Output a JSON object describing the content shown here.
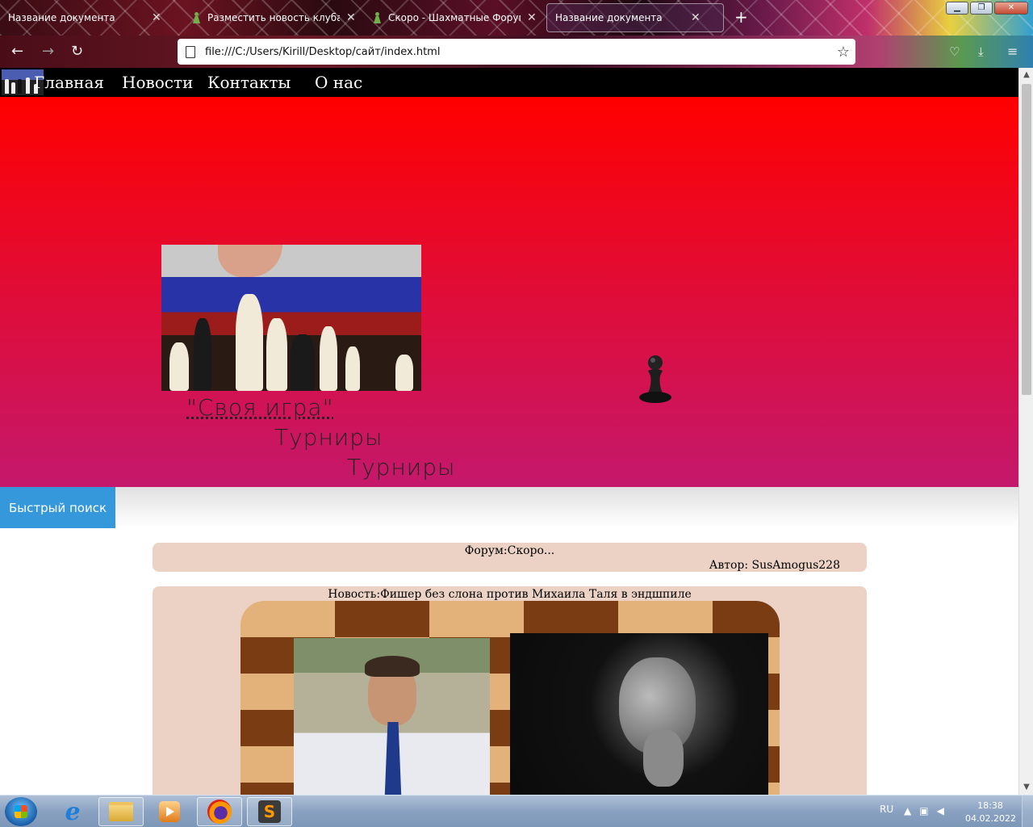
{
  "browser": {
    "tabs": [
      {
        "title": "Название документа",
        "favicon": "none",
        "active": false
      },
      {
        "title": "Разместить новость клуба - Ch",
        "favicon": "pawn-icon",
        "active": false
      },
      {
        "title": "Скоро - Шахматные Форумы",
        "favicon": "pawn-icon",
        "active": false
      },
      {
        "title": "Название документа",
        "favicon": "none",
        "active": true
      }
    ],
    "new_tab": "+",
    "url": "file:///C:/Users/Kirill/Desktop/сайт/index.html"
  },
  "site": {
    "nav": [
      {
        "label": "Главная"
      },
      {
        "label": "Новости"
      },
      {
        "label": "Контакты"
      },
      {
        "label": "О нас"
      }
    ],
    "hero": {
      "link": "\"Своя игра\"",
      "line1": "Турниры",
      "line2": "Турниры"
    },
    "quick_search": "Быстрый поиск",
    "forum_card": {
      "title": "Форум:Скоро...",
      "author": "Автор: SusAmogus228"
    },
    "news_card": {
      "title": "Новость:Фишер без слона против Михаила Таля в эндшпиле"
    }
  },
  "taskbar": {
    "lang": "RU",
    "time": "18:38",
    "date": "04.02.2022"
  },
  "colors": {
    "hero_top": "#ff0000",
    "hero_bottom": "#c4186c",
    "quick_search": "#3498db",
    "card_bg": "#ecd2c4"
  }
}
